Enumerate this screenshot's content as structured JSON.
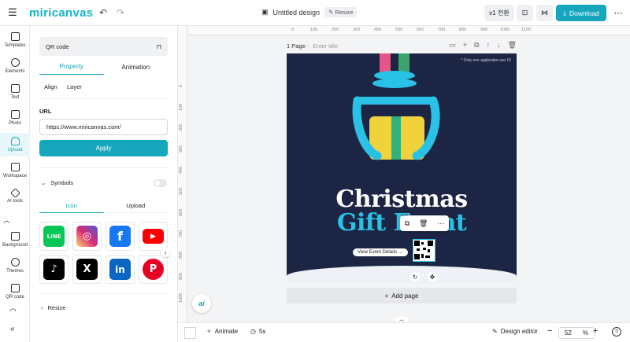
{
  "app": {
    "logo": "miricanvas",
    "doc_title": "Untitled design",
    "resize_label": "Resize",
    "version_label": "v1 전환",
    "download_label": "Download"
  },
  "sidebar": {
    "items": [
      {
        "label": "Templates",
        "icon": "templates-icon"
      },
      {
        "label": "Elements",
        "icon": "elements-icon"
      },
      {
        "label": "Text",
        "icon": "text-icon"
      },
      {
        "label": "Photo",
        "icon": "photo-icon"
      },
      {
        "label": "Upload",
        "icon": "upload-icon",
        "active": true
      },
      {
        "label": "Workspace",
        "icon": "workspace-icon"
      },
      {
        "label": "AI tools",
        "icon": "ai-tools-icon"
      },
      {
        "label": "Background",
        "icon": "background-icon"
      },
      {
        "label": "Themes",
        "icon": "themes-icon"
      },
      {
        "label": "QR code",
        "icon": "qr-code-icon"
      }
    ]
  },
  "panel": {
    "title": "QR code",
    "tabs": [
      "Property",
      "Animation"
    ],
    "subtabs": [
      "Align",
      "Layer"
    ],
    "url_label": "URL",
    "url_value": "https://www.miricanvas.com/",
    "apply_label": "Apply",
    "symbols_label": "Symbols",
    "icon_tabs": [
      "Icon",
      "Upload"
    ],
    "resize_label": "Resize",
    "social": [
      {
        "name": "LINE",
        "color": "#06c755",
        "glyph": "LINE"
      },
      {
        "name": "Instagram",
        "color": "#d6249f",
        "glyph": "◎"
      },
      {
        "name": "Facebook",
        "color": "#1877f2",
        "glyph": "f"
      },
      {
        "name": "YouTube",
        "color": "#ff0000",
        "glyph": "▶"
      },
      {
        "name": "TikTok",
        "color": "#000000",
        "glyph": "♪"
      },
      {
        "name": "X",
        "color": "#000000",
        "glyph": "X"
      },
      {
        "name": "LinkedIn",
        "color": "#0a66c2",
        "glyph": "in"
      },
      {
        "name": "Pinterest",
        "color": "#e60023",
        "glyph": "P"
      }
    ]
  },
  "canvas": {
    "page_label": "1 Page",
    "page_title_placeholder": "Enter title",
    "ruler_top": [
      "0",
      "100",
      "200",
      "300",
      "400",
      "500",
      "600",
      "700",
      "800",
      "900",
      "1000",
      "1100"
    ],
    "ruler_left": [
      "0",
      "100",
      "200",
      "300",
      "400",
      "500",
      "600",
      "700",
      "800",
      "900",
      "1000"
    ],
    "fine_print": "* Only one application per ID",
    "heading1": "Christmas",
    "heading2": "Gift Event",
    "cta": "View Event Details →",
    "add_page": "Add page"
  },
  "bottom": {
    "animate": "Animate",
    "duration": "5s",
    "design_editor": "Design editor",
    "zoom": "52",
    "zoom_unit": "%"
  },
  "colors": {
    "accent": "#16a7bd",
    "artboard_bg": "#1c2544",
    "heading2": "#29c2e6"
  }
}
